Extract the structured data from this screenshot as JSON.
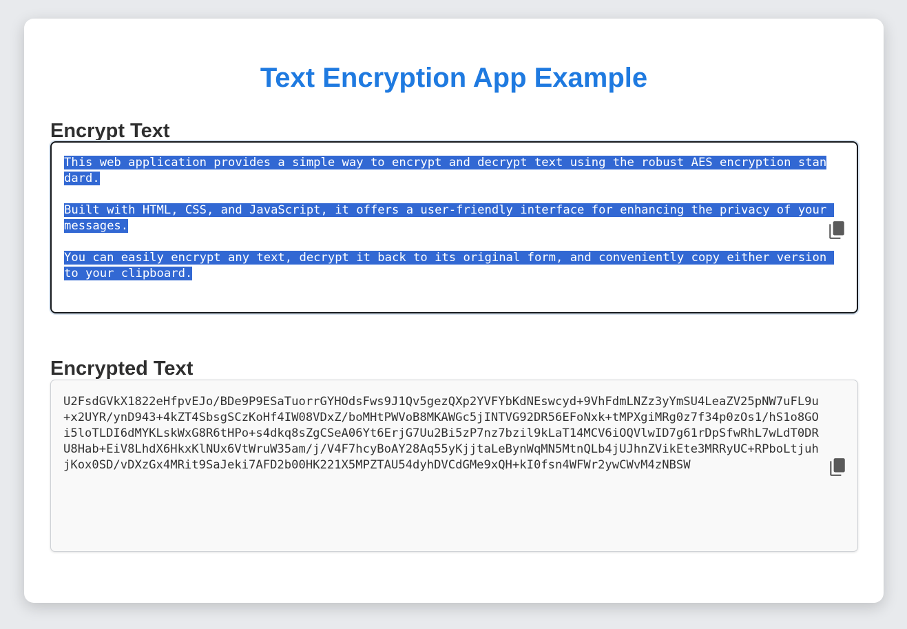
{
  "app": {
    "title": "Text Encryption App Example"
  },
  "encrypt": {
    "heading": "Encrypt Text",
    "input_value": "This web application provides a simple way to encrypt and decrypt text using the robust AES encryption standard.\n\nBuilt with HTML, CSS, and JavaScript, it offers a user-friendly interface for enhancing the privacy of your messages.\n\nYou can easily encrypt any text, decrypt it back to its original form, and conveniently copy either version to your clipboard.",
    "copy_icon": "copy-icon"
  },
  "encrypted": {
    "heading": "Encrypted Text",
    "output_value": "U2FsdGVkX1822eHfpvEJo/BDe9P9ESaTuorrGYHOdsFws9J1Qv5gezQXp2YVFYbKdNEswcyd+9VhFdmLNZz3yYmSU4LeaZV25pNW7uFL9u+x2UYR/ynD943+4kZT4SbsgSCzKoHf4IW08VDxZ/boMHtPWVoB8MKAWGc5jINTVG92DR56EFoNxk+tMPXgiMRg0z7f34p0zOs1/hS1o8GOi5loTLDI6dMYKLskWxG8R6tHPo+s4dkq8sZgCSeA06Yt6ErjG7Uu2Bi5zP7nz7bzil9kLaT14MCV6iOQVlwID7g61rDpSfwRhL7wLdT0DRU8Hab+EiV8LhdX6HkxKlNUx6VtWruW35am/j/V4F7hcyBoAY28Aq55yKjjtaLeBynWqMN5MtnQLb4jUJhnZVikEte3MRRyUC+RPboLtjuhjKox0SD/vDXzGx4MRit9SaJeki7AFD2b00HK221X5MPZTAU54dyhDVCdGMe9xQH+kI0fsn4WFWr2ywCWvM4zNBSW",
    "copy_icon": "copy-icon"
  },
  "colors": {
    "title": "#1f7ae0",
    "selection": "#3268d3",
    "background": "#e8eaed"
  }
}
